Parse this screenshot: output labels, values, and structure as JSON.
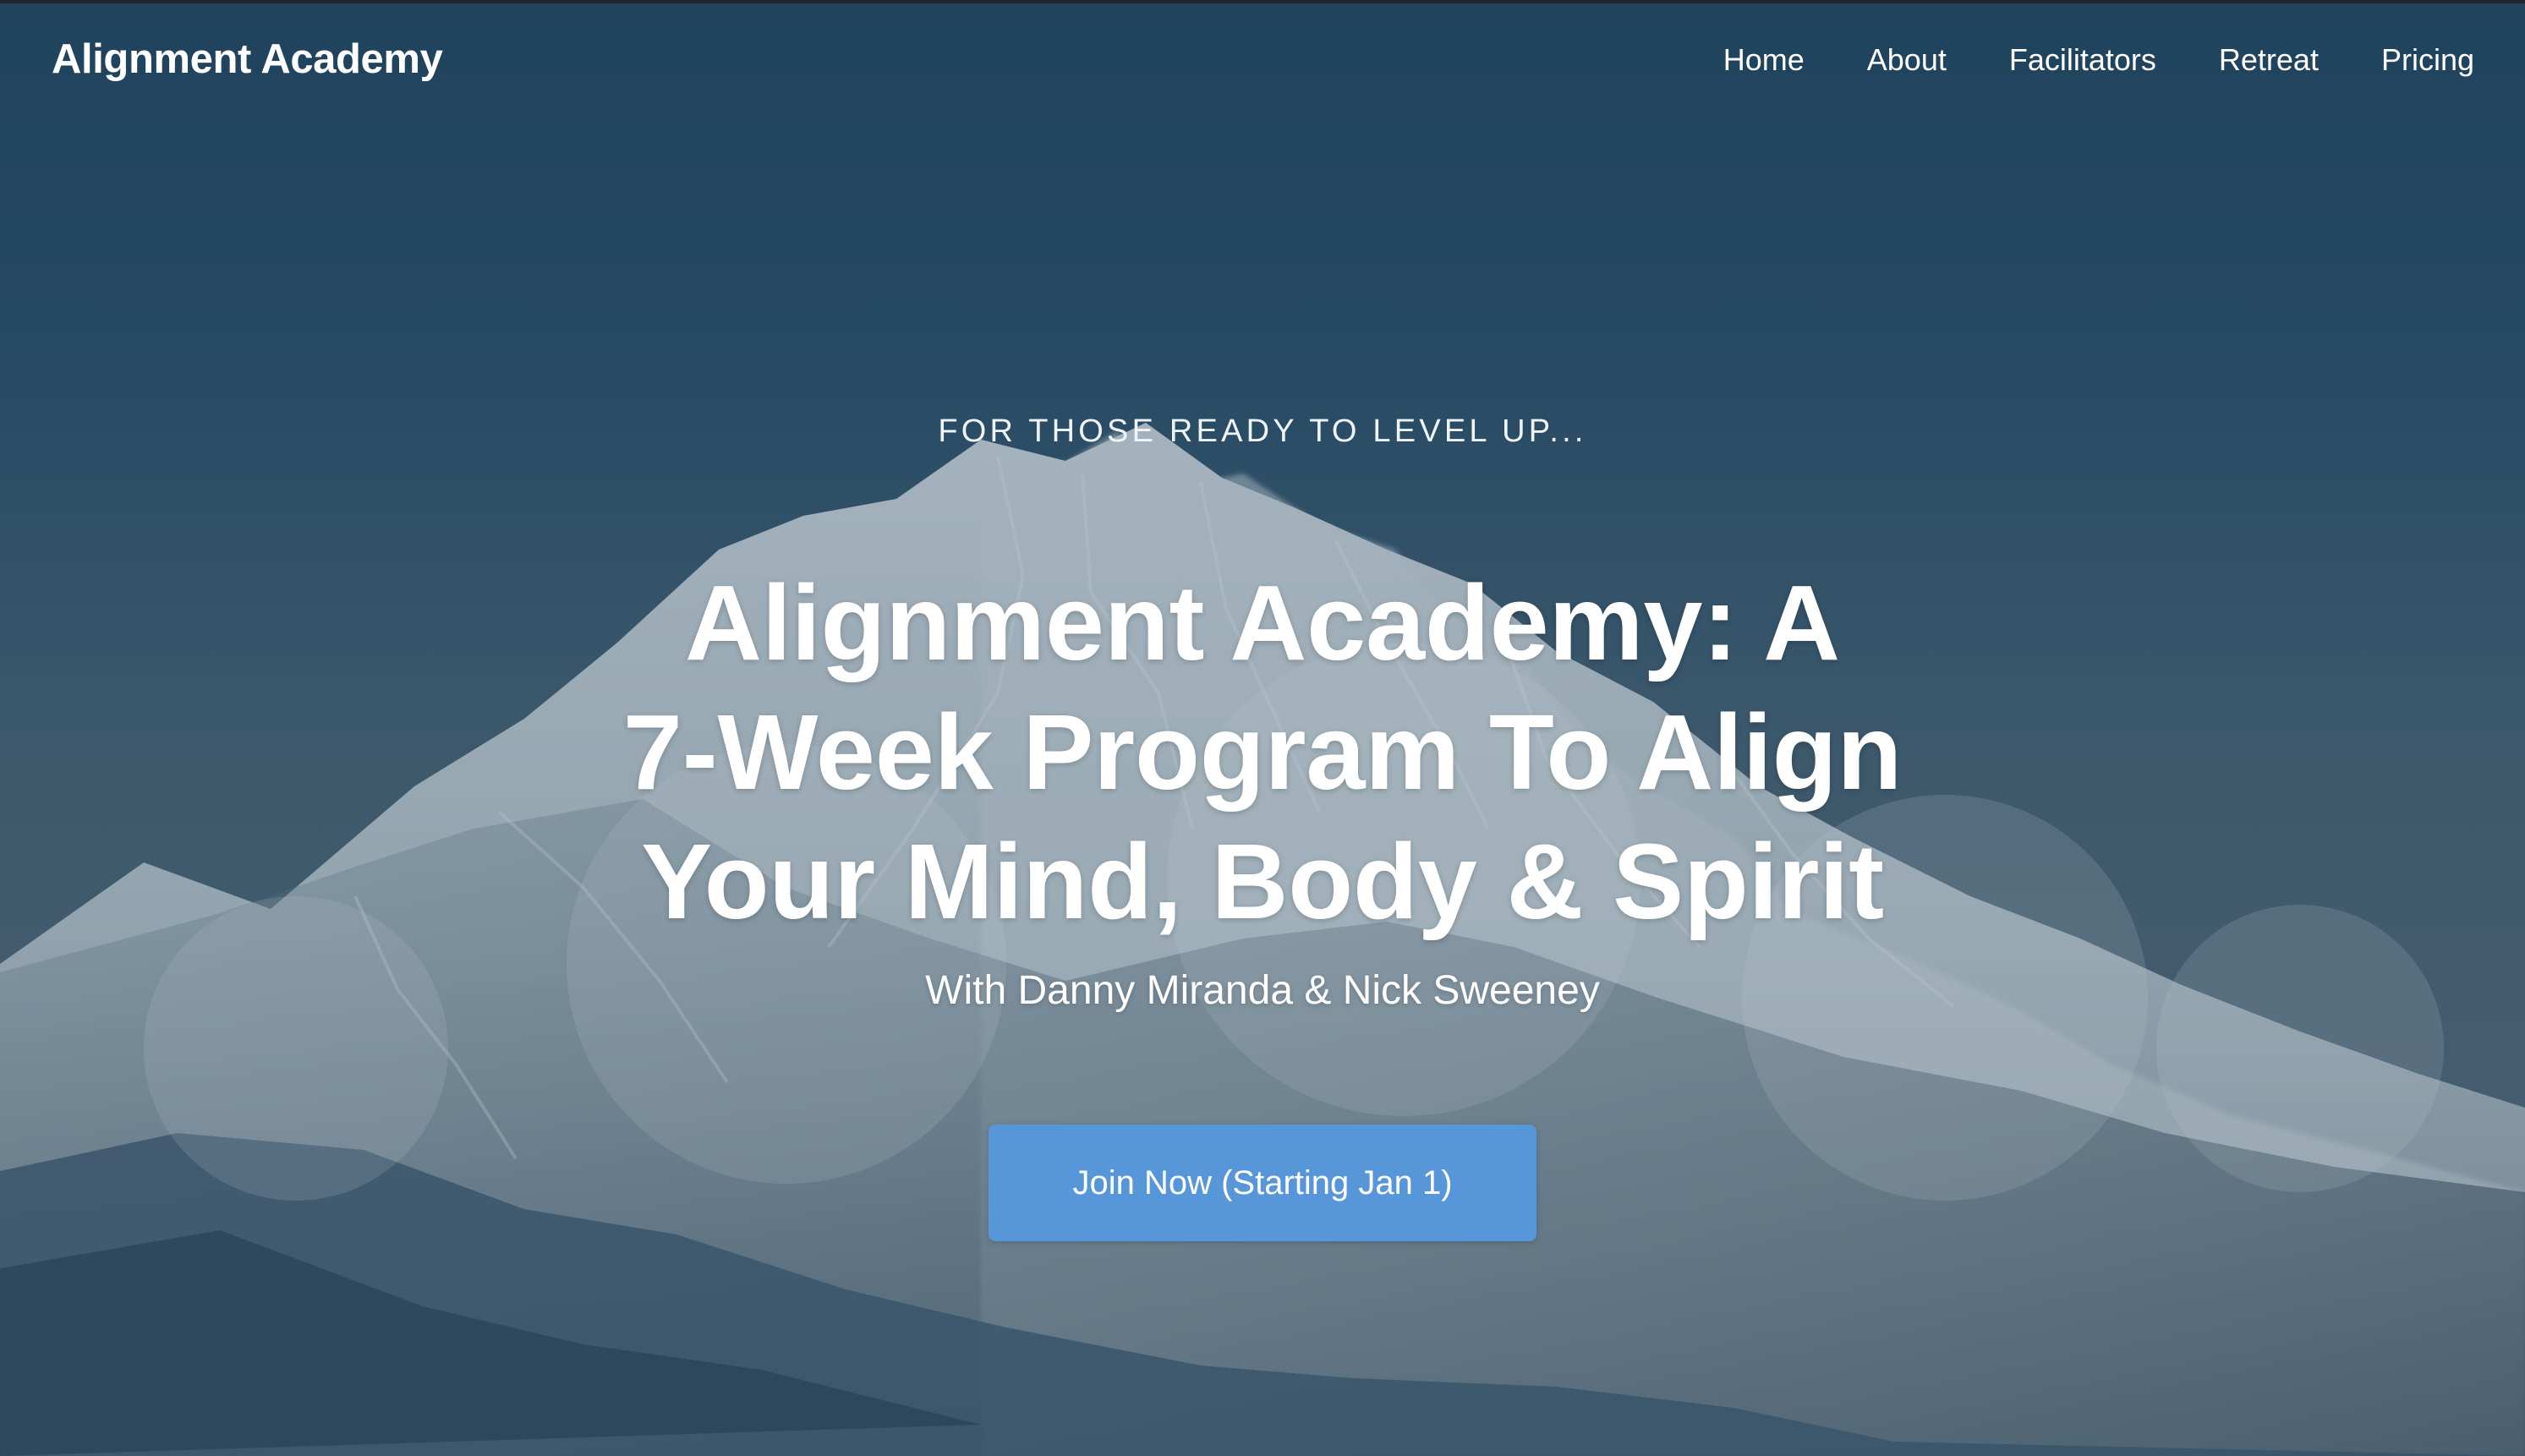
{
  "site": {
    "brand": "Alignment Academy",
    "nav": [
      {
        "label": "Home"
      },
      {
        "label": "About"
      },
      {
        "label": "Facilitators"
      },
      {
        "label": "Retreat"
      },
      {
        "label": "Pricing"
      }
    ]
  },
  "hero": {
    "eyebrow": "FOR THOSE READY TO LEVEL UP...",
    "headline_lines": [
      "Alignment Academy: A",
      "7-Week Program To Align",
      "Your Mind, Body & Spirit"
    ],
    "subheadline": "With Danny Miranda & Nick Sweeney",
    "cta_label": "Join Now (Starting Jan 1)",
    "background": {
      "icon": "snow-mountain-image"
    }
  },
  "colors": {
    "accent": "#5796D9",
    "sky_top": "#1D3F59",
    "mountain_snow": "#D8DEE2",
    "overlay": "#3F5566"
  }
}
